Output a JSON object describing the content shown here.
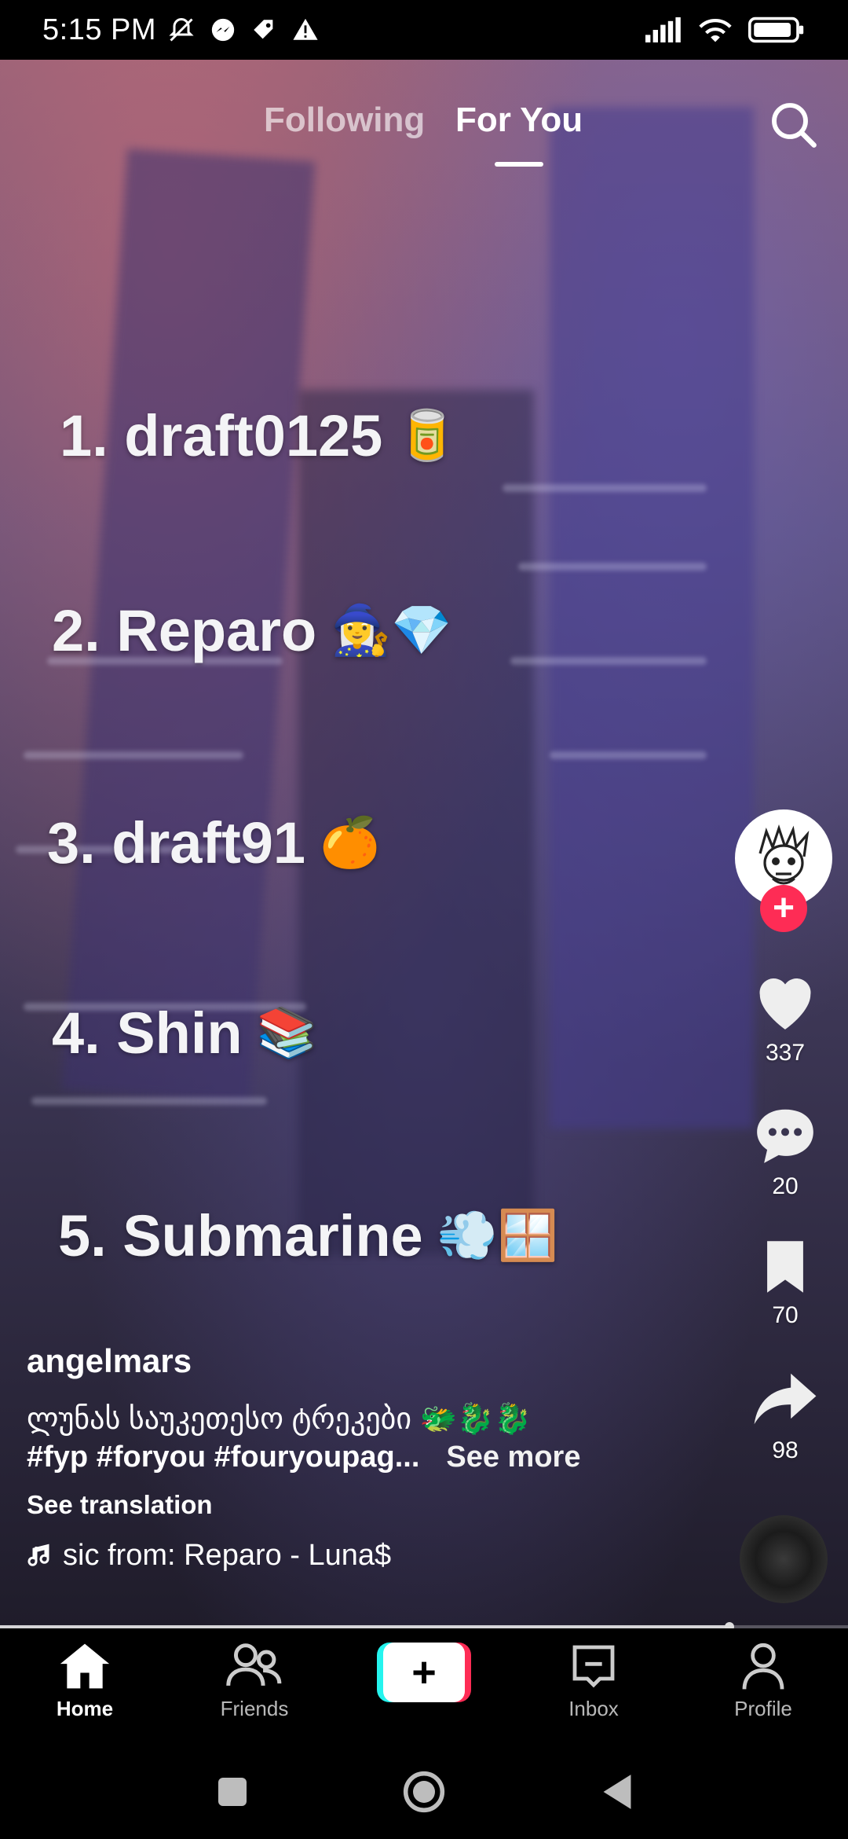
{
  "status_bar": {
    "time": "5:15 PM",
    "left_icons": [
      "notifications-off-icon",
      "messenger-icon",
      "tag-icon",
      "warning-icon"
    ],
    "right_icons": [
      "signal-icon",
      "wifi-icon",
      "battery-icon"
    ]
  },
  "feed_tabs": {
    "following": "Following",
    "for_you": "For You",
    "active": "For You"
  },
  "overlay_list": [
    {
      "text": "1. draft0125",
      "emoji": "🥫"
    },
    {
      "text": "2. Reparo",
      "emoji": "🧙‍♀️💎"
    },
    {
      "text": "3. draft91",
      "emoji": "🍊"
    },
    {
      "text": "4. Shin",
      "emoji": "📚"
    },
    {
      "text": "5. Submarine",
      "emoji": "💨🪟"
    }
  ],
  "actions": {
    "likes": "337",
    "comments": "20",
    "saves": "70",
    "shares": "98"
  },
  "caption": {
    "username": "angelmars",
    "description_line1": "ლუნას საუკეთესო ტრეკები 🐲🐉🐉",
    "hashtags": "#fyp #foryou #fouryoupag...",
    "see_more": "See more",
    "see_translation": "See translation",
    "music": "sic from: Reparo - Luna$"
  },
  "video_progress": 0.86,
  "bottom_nav": {
    "home": "Home",
    "friends": "Friends",
    "create": "+",
    "inbox": "Inbox",
    "profile": "Profile",
    "active": "Home"
  },
  "colors": {
    "accent_red": "#fe2c55",
    "accent_cyan": "#25f4ee"
  }
}
